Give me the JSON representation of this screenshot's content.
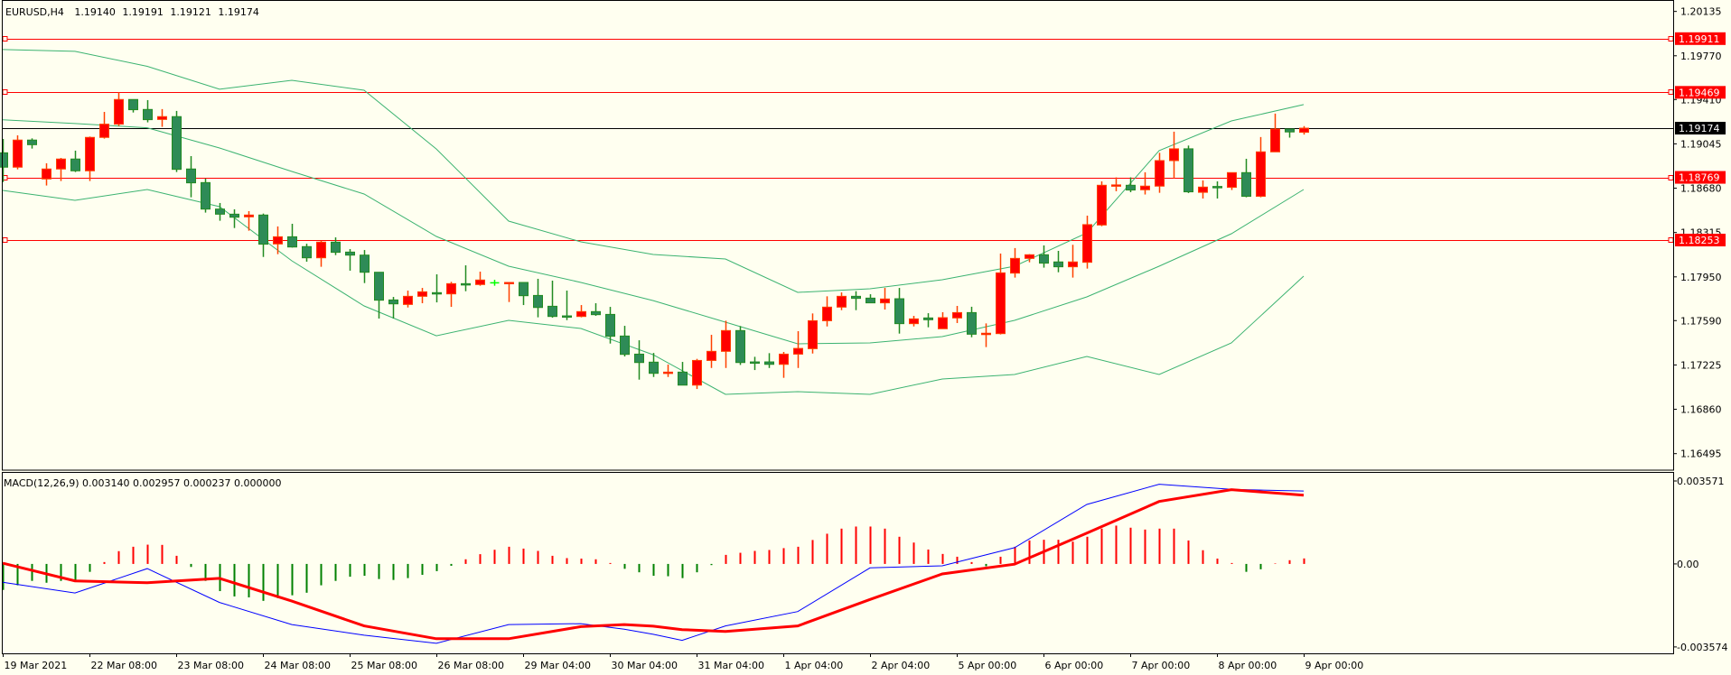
{
  "chart_data": {
    "type": "candlestick",
    "header": {
      "symbol": "EURUSD,H4",
      "open": "1.19140",
      "high": "1.19191",
      "low": "1.19121",
      "close": "1.19174"
    },
    "xlim": [
      -0.1875,
      115.56
    ],
    "ylim": [
      1.16359,
      1.20229
    ],
    "price_ticks": [
      "1.20135",
      "1.19770",
      "1.19410",
      "1.19045",
      "1.18680",
      "1.18315",
      "1.17950",
      "1.17590",
      "1.17225",
      "1.16860",
      "1.16495"
    ],
    "hlines": [
      {
        "value": "1.19911",
        "color": "#ff0000"
      },
      {
        "value": "1.19469",
        "color": "#ff0000"
      },
      {
        "value": "1.18769",
        "color": "#ff0000"
      },
      {
        "value": "1.18253",
        "color": "#ff0000"
      }
    ],
    "current_price": {
      "value": "1.19174",
      "color": "#000000"
    },
    "colors": {
      "bull_body": "#ff0000",
      "bull_line": "#ff4000",
      "bear_body": "#2e8b57",
      "bear_line": "#228b22",
      "doji": "#00ff00",
      "bands": "#3cb371",
      "background": "#fffff0"
    },
    "candles_ohlc": [
      [
        1.18971,
        1.19085,
        1.18731,
        1.18853
      ],
      [
        1.18853,
        1.19115,
        1.18835,
        1.19076
      ],
      [
        1.19076,
        1.1909,
        1.19006,
        1.19038
      ],
      [
        1.18756,
        1.18885,
        1.18702,
        1.18838
      ],
      [
        1.18838,
        1.18929,
        1.18739,
        1.1892
      ],
      [
        1.1892,
        1.18989,
        1.18813,
        1.18823
      ],
      [
        1.18823,
        1.19105,
        1.18739,
        1.19098
      ],
      [
        1.19098,
        1.19308,
        1.19088,
        1.19207
      ],
      [
        1.19207,
        1.19469,
        1.19192,
        1.1941
      ],
      [
        1.1941,
        1.1941,
        1.19303,
        1.19326
      ],
      [
        1.19328,
        1.19405,
        1.19222,
        1.19244
      ],
      [
        1.19246,
        1.19331,
        1.19185,
        1.19269
      ],
      [
        1.19269,
        1.19316,
        1.18813,
        1.18835
      ],
      [
        1.18838,
        1.18944,
        1.18605,
        1.18724
      ],
      [
        1.18726,
        1.18759,
        1.18479,
        1.18508
      ],
      [
        1.18508,
        1.18558,
        1.18412,
        1.18466
      ],
      [
        1.18466,
        1.18506,
        1.18352,
        1.18441
      ],
      [
        1.18444,
        1.18491,
        1.1833,
        1.18459
      ],
      [
        1.18459,
        1.18471,
        1.18114,
        1.18219
      ],
      [
        1.18221,
        1.18365,
        1.18137,
        1.1828
      ],
      [
        1.1828,
        1.18387,
        1.18191,
        1.18196
      ],
      [
        1.18199,
        1.18223,
        1.18075,
        1.18107
      ],
      [
        1.18107,
        1.18248,
        1.18033,
        1.18236
      ],
      [
        1.18236,
        1.18275,
        1.18129,
        1.18152
      ],
      [
        1.18154,
        1.18179,
        1.18001,
        1.18129
      ],
      [
        1.18129,
        1.18171,
        1.17899,
        1.17988
      ],
      [
        1.17988,
        1.17988,
        1.17607,
        1.17758
      ],
      [
        1.1776,
        1.17785,
        1.17607,
        1.17728
      ],
      [
        1.17723,
        1.17837,
        1.17698,
        1.1779
      ],
      [
        1.1779,
        1.17859,
        1.17733,
        1.17827
      ],
      [
        1.1782,
        1.17971,
        1.1774,
        1.1781
      ],
      [
        1.1781,
        1.17909,
        1.17703,
        1.17894
      ],
      [
        1.17894,
        1.18045,
        1.17832,
        1.17887
      ],
      [
        1.17887,
        1.17993,
        1.17877,
        1.17924
      ],
      [
        1.17901,
        1.17926,
        1.17877,
        1.17901
      ],
      [
        1.17894,
        1.17904,
        1.17743,
        1.17904
      ],
      [
        1.17904,
        1.17904,
        1.17718,
        1.17795
      ],
      [
        1.17797,
        1.17934,
        1.17617,
        1.17698
      ],
      [
        1.17708,
        1.17919,
        1.17614,
        1.17624
      ],
      [
        1.17629,
        1.17837,
        1.17594,
        1.17624
      ],
      [
        1.17624,
        1.17718,
        1.17617,
        1.17664
      ],
      [
        1.17664,
        1.17733,
        1.17629,
        1.17639
      ],
      [
        1.17641,
        1.17703,
        1.17401,
        1.17461
      ],
      [
        1.17463,
        1.17547,
        1.17295,
        1.17312
      ],
      [
        1.17314,
        1.17428,
        1.17104,
        1.17245
      ],
      [
        1.17248,
        1.17324,
        1.17126,
        1.17156
      ],
      [
        1.17156,
        1.17228,
        1.17126,
        1.17166
      ],
      [
        1.17166,
        1.1725,
        1.17059,
        1.17059
      ],
      [
        1.17059,
        1.17275,
        1.17027,
        1.17262
      ],
      [
        1.17262,
        1.17473,
        1.172,
        1.17337
      ],
      [
        1.17337,
        1.17589,
        1.172,
        1.17508
      ],
      [
        1.17508,
        1.17545,
        1.17225,
        1.17245
      ],
      [
        1.1725,
        1.17292,
        1.17183,
        1.17245
      ],
      [
        1.1725,
        1.17322,
        1.172,
        1.1723
      ],
      [
        1.1723,
        1.17332,
        1.17119,
        1.17314
      ],
      [
        1.17314,
        1.17503,
        1.172,
        1.17361
      ],
      [
        1.17359,
        1.17649,
        1.17319,
        1.17589
      ],
      [
        1.17589,
        1.1779,
        1.17542,
        1.17701
      ],
      [
        1.17701,
        1.17822,
        1.17676,
        1.1779
      ],
      [
        1.1779,
        1.17832,
        1.17676,
        1.17773
      ],
      [
        1.17775,
        1.17807,
        1.17736,
        1.17736
      ],
      [
        1.17736,
        1.17859,
        1.17681,
        1.17768
      ],
      [
        1.1777,
        1.17859,
        1.17483,
        1.17565
      ],
      [
        1.17565,
        1.17629,
        1.17542,
        1.17604
      ],
      [
        1.17612,
        1.17651,
        1.17535,
        1.17597
      ],
      [
        1.17523,
        1.17659,
        1.17523,
        1.17614
      ],
      [
        1.17612,
        1.17711,
        1.1757,
        1.17656
      ],
      [
        1.17656,
        1.17704,
        1.17453,
        1.17478
      ],
      [
        1.17478,
        1.17567,
        1.17372,
        1.17486
      ],
      [
        1.17483,
        1.18142,
        1.17476,
        1.17983
      ],
      [
        1.17981,
        1.18187,
        1.17944,
        1.18102
      ],
      [
        1.18102,
        1.18137,
        1.1807,
        1.18132
      ],
      [
        1.18132,
        1.18209,
        1.18026,
        1.18063
      ],
      [
        1.18073,
        1.18164,
        1.17988,
        1.18033
      ],
      [
        1.18033,
        1.18214,
        1.17944,
        1.18073
      ],
      [
        1.1807,
        1.18454,
        1.18018,
        1.1838
      ],
      [
        1.18377,
        1.18736,
        1.18367,
        1.18704
      ],
      [
        1.18702,
        1.18769,
        1.18655,
        1.18707
      ],
      [
        1.18704,
        1.18769,
        1.18647,
        1.18665
      ],
      [
        1.18667,
        1.18811,
        1.18628,
        1.18697
      ],
      [
        1.18697,
        1.18971,
        1.18642,
        1.18907
      ],
      [
        1.18907,
        1.19145,
        1.18761,
        1.19004
      ],
      [
        1.19004,
        1.19031,
        1.1864,
        1.1865
      ],
      [
        1.18646,
        1.18744,
        1.18595,
        1.18689
      ],
      [
        1.18694,
        1.18736,
        1.18595,
        1.18687
      ],
      [
        1.18687,
        1.18808,
        1.18665,
        1.18808
      ],
      [
        1.18808,
        1.18922,
        1.18605,
        1.18613
      ],
      [
        1.18613,
        1.19101,
        1.18605,
        1.18979
      ],
      [
        1.18979,
        1.19294,
        1.18979,
        1.19167
      ],
      [
        1.19167,
        1.19167,
        1.19096,
        1.19143
      ],
      [
        1.1914,
        1.19191,
        1.19121,
        1.19174
      ]
    ],
    "bollinger": {
      "upper": [
        [
          0,
          1.19821
        ],
        [
          5,
          1.19806
        ],
        [
          10,
          1.19683
        ],
        [
          15,
          1.19494
        ],
        [
          20,
          1.19568
        ],
        [
          25,
          1.19486
        ],
        [
          30,
          1.19003
        ],
        [
          35,
          1.18409
        ],
        [
          40,
          1.18238
        ],
        [
          45,
          1.18134
        ],
        [
          50,
          1.18097
        ],
        [
          55,
          1.17822
        ],
        [
          60,
          1.17852
        ],
        [
          65,
          1.17926
        ],
        [
          70,
          1.18038
        ],
        [
          75,
          1.18312
        ],
        [
          80,
          1.18989
        ],
        [
          85,
          1.19234
        ],
        [
          90,
          1.19368
        ]
      ],
      "middle": [
        [
          0,
          1.19243
        ],
        [
          5,
          1.19212
        ],
        [
          10,
          1.19177
        ],
        [
          15,
          1.19011
        ],
        [
          20,
          1.18818
        ],
        [
          25,
          1.18632
        ],
        [
          30,
          1.18283
        ],
        [
          35,
          1.18038
        ],
        [
          40,
          1.17904
        ],
        [
          45,
          1.17755
        ],
        [
          50,
          1.17577
        ],
        [
          55,
          1.17399
        ],
        [
          60,
          1.17406
        ],
        [
          65,
          1.17458
        ],
        [
          70,
          1.17592
        ],
        [
          75,
          1.17785
        ],
        [
          80,
          1.18038
        ],
        [
          85,
          1.18305
        ],
        [
          90,
          1.18669
        ]
      ],
      "lower": [
        [
          0,
          1.18662
        ],
        [
          5,
          1.1858
        ],
        [
          10,
          1.18669
        ],
        [
          15,
          1.18528
        ],
        [
          20,
          1.18082
        ],
        [
          25,
          1.17711
        ],
        [
          30,
          1.17465
        ],
        [
          35,
          1.17592
        ],
        [
          40,
          1.17525
        ],
        [
          45,
          1.17309
        ],
        [
          50,
          1.16983
        ],
        [
          55,
          1.17005
        ],
        [
          60,
          1.16983
        ],
        [
          65,
          1.17109
        ],
        [
          70,
          1.17146
        ],
        [
          75,
          1.17295
        ],
        [
          80,
          1.17146
        ],
        [
          85,
          1.17406
        ],
        [
          90,
          1.17956
        ]
      ]
    },
    "time_labels": [
      {
        "index": 0,
        "label": "19 Mar 2021"
      },
      {
        "index": 6,
        "label": "22 Mar 08:00"
      },
      {
        "index": 12,
        "label": "23 Mar 08:00"
      },
      {
        "index": 18,
        "label": "24 Mar 08:00"
      },
      {
        "index": 24,
        "label": "25 Mar 08:00"
      },
      {
        "index": 30,
        "label": "26 Mar 08:00"
      },
      {
        "index": 36,
        "label": "29 Mar 04:00"
      },
      {
        "index": 42,
        "label": "30 Mar 04:00"
      },
      {
        "index": 48,
        "label": "31 Mar 04:00"
      },
      {
        "index": 54,
        "label": "1 Apr 04:00"
      },
      {
        "index": 60,
        "label": "2 Apr 04:00"
      },
      {
        "index": 66,
        "label": "5 Apr 00:00"
      },
      {
        "index": 72,
        "label": "6 Apr 00:00"
      },
      {
        "index": 78,
        "label": "7 Apr 00:00"
      },
      {
        "index": 84,
        "label": "8 Apr 00:00"
      },
      {
        "index": 90,
        "label": "9 Apr 00:00"
      }
    ],
    "macd": {
      "label": "MACD(12,26,9) 0.003140 0.002957 0.000237 0.000000",
      "ylim": [
        -0.00385,
        0.00396
      ],
      "ticks": [
        {
          "value": 0.003571,
          "label": "0.003571"
        },
        {
          "value": 0,
          "label": "0.00"
        },
        {
          "value": -0.003574,
          "label": "-0.003574"
        }
      ],
      "colors": {
        "main": "#0000ff",
        "signal": "#ff0000",
        "hist_pos": "#ff0000",
        "hist_neg": "#008000"
      },
      "histogram": [
        -0.00112,
        -0.00092,
        -0.00073,
        -0.00081,
        -0.00073,
        -0.0007,
        -0.00034,
        8e-05,
        0.00055,
        0.00074,
        0.00083,
        0.00082,
        0.00035,
        -0.00013,
        -0.00073,
        -0.00117,
        -0.0014,
        -0.00144,
        -0.00159,
        -0.00147,
        -0.00135,
        -0.00124,
        -0.00092,
        -0.00073,
        -0.00055,
        -0.00051,
        -0.00065,
        -0.00069,
        -0.00061,
        -0.00047,
        -0.00031,
        -8e-05,
        0.0002,
        0.00042,
        0.00061,
        0.00074,
        0.00066,
        0.00056,
        0.00035,
        0.00025,
        0.00023,
        0.0002,
        4e-05,
        -0.00021,
        -0.00036,
        -0.00051,
        -0.00053,
        -0.00061,
        -0.00036,
        -5e-05,
        0.00039,
        0.00048,
        0.00056,
        0.0006,
        0.00068,
        0.00074,
        0.00103,
        0.0013,
        0.00152,
        0.00161,
        0.00161,
        0.00152,
        0.00117,
        0.00092,
        0.00062,
        0.00043,
        0.00031,
        8e-05,
        -0.0001,
        0.00031,
        0.00074,
        0.00101,
        0.00104,
        0.00104,
        0.00096,
        0.00117,
        0.00152,
        0.00165,
        0.00156,
        0.00148,
        0.00152,
        0.00152,
        0.00101,
        0.00059,
        0.00023,
        4e-05,
        -0.00034,
        -0.00023,
        2e-05,
        0.00016,
        0.000237
      ],
      "main": [
        [
          0,
          -0.00079
        ],
        [
          5,
          -0.00125
        ],
        [
          10,
          -0.0002
        ],
        [
          15,
          -0.00166
        ],
        [
          20,
          -0.00261
        ],
        [
          25,
          -0.00307
        ],
        [
          30,
          -0.00342
        ],
        [
          35,
          -0.00261
        ],
        [
          40,
          -0.00257
        ],
        [
          43,
          -0.00281
        ],
        [
          45,
          -0.00303
        ],
        [
          47,
          -0.00329
        ],
        [
          50,
          -0.00267
        ],
        [
          55,
          -0.00205
        ],
        [
          60,
          -0.00017
        ],
        [
          65,
          -8e-05
        ],
        [
          70,
          0.0007
        ],
        [
          75,
          0.00256
        ],
        [
          80,
          0.00343
        ],
        [
          85,
          0.00321
        ],
        [
          90,
          0.00314
        ]
      ],
      "signal": [
        [
          0,
          3e-05
        ],
        [
          5,
          -0.00073
        ],
        [
          10,
          -0.00081
        ],
        [
          15,
          -0.00062
        ],
        [
          20,
          -0.0016
        ],
        [
          25,
          -0.00267
        ],
        [
          30,
          -0.00322
        ],
        [
          35,
          -0.00322
        ],
        [
          40,
          -0.0027
        ],
        [
          43,
          -0.00261
        ],
        [
          45,
          -0.00268
        ],
        [
          47,
          -0.00283
        ],
        [
          50,
          -0.00291
        ],
        [
          55,
          -0.00267
        ],
        [
          60,
          -0.00153
        ],
        [
          65,
          -0.00043
        ],
        [
          70,
          -1e-05
        ],
        [
          75,
          0.00133
        ],
        [
          80,
          0.00269
        ],
        [
          85,
          0.0032
        ],
        [
          90,
          0.002957
        ]
      ]
    }
  }
}
